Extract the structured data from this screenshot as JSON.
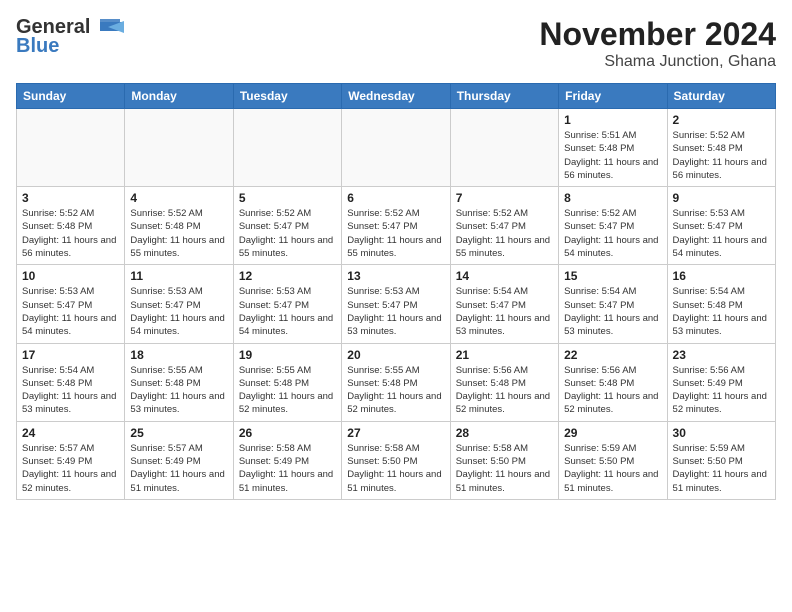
{
  "header": {
    "logo_general": "General",
    "logo_blue": "Blue",
    "title": "November 2024",
    "subtitle": "Shama Junction, Ghana"
  },
  "days_of_week": [
    "Sunday",
    "Monday",
    "Tuesday",
    "Wednesday",
    "Thursday",
    "Friday",
    "Saturday"
  ],
  "weeks": [
    [
      {
        "day": "",
        "info": ""
      },
      {
        "day": "",
        "info": ""
      },
      {
        "day": "",
        "info": ""
      },
      {
        "day": "",
        "info": ""
      },
      {
        "day": "",
        "info": ""
      },
      {
        "day": "1",
        "info": "Sunrise: 5:51 AM\nSunset: 5:48 PM\nDaylight: 11 hours and 56 minutes."
      },
      {
        "day": "2",
        "info": "Sunrise: 5:52 AM\nSunset: 5:48 PM\nDaylight: 11 hours and 56 minutes."
      }
    ],
    [
      {
        "day": "3",
        "info": "Sunrise: 5:52 AM\nSunset: 5:48 PM\nDaylight: 11 hours and 56 minutes."
      },
      {
        "day": "4",
        "info": "Sunrise: 5:52 AM\nSunset: 5:48 PM\nDaylight: 11 hours and 55 minutes."
      },
      {
        "day": "5",
        "info": "Sunrise: 5:52 AM\nSunset: 5:47 PM\nDaylight: 11 hours and 55 minutes."
      },
      {
        "day": "6",
        "info": "Sunrise: 5:52 AM\nSunset: 5:47 PM\nDaylight: 11 hours and 55 minutes."
      },
      {
        "day": "7",
        "info": "Sunrise: 5:52 AM\nSunset: 5:47 PM\nDaylight: 11 hours and 55 minutes."
      },
      {
        "day": "8",
        "info": "Sunrise: 5:52 AM\nSunset: 5:47 PM\nDaylight: 11 hours and 54 minutes."
      },
      {
        "day": "9",
        "info": "Sunrise: 5:53 AM\nSunset: 5:47 PM\nDaylight: 11 hours and 54 minutes."
      }
    ],
    [
      {
        "day": "10",
        "info": "Sunrise: 5:53 AM\nSunset: 5:47 PM\nDaylight: 11 hours and 54 minutes."
      },
      {
        "day": "11",
        "info": "Sunrise: 5:53 AM\nSunset: 5:47 PM\nDaylight: 11 hours and 54 minutes."
      },
      {
        "day": "12",
        "info": "Sunrise: 5:53 AM\nSunset: 5:47 PM\nDaylight: 11 hours and 54 minutes."
      },
      {
        "day": "13",
        "info": "Sunrise: 5:53 AM\nSunset: 5:47 PM\nDaylight: 11 hours and 53 minutes."
      },
      {
        "day": "14",
        "info": "Sunrise: 5:54 AM\nSunset: 5:47 PM\nDaylight: 11 hours and 53 minutes."
      },
      {
        "day": "15",
        "info": "Sunrise: 5:54 AM\nSunset: 5:47 PM\nDaylight: 11 hours and 53 minutes."
      },
      {
        "day": "16",
        "info": "Sunrise: 5:54 AM\nSunset: 5:48 PM\nDaylight: 11 hours and 53 minutes."
      }
    ],
    [
      {
        "day": "17",
        "info": "Sunrise: 5:54 AM\nSunset: 5:48 PM\nDaylight: 11 hours and 53 minutes."
      },
      {
        "day": "18",
        "info": "Sunrise: 5:55 AM\nSunset: 5:48 PM\nDaylight: 11 hours and 53 minutes."
      },
      {
        "day": "19",
        "info": "Sunrise: 5:55 AM\nSunset: 5:48 PM\nDaylight: 11 hours and 52 minutes."
      },
      {
        "day": "20",
        "info": "Sunrise: 5:55 AM\nSunset: 5:48 PM\nDaylight: 11 hours and 52 minutes."
      },
      {
        "day": "21",
        "info": "Sunrise: 5:56 AM\nSunset: 5:48 PM\nDaylight: 11 hours and 52 minutes."
      },
      {
        "day": "22",
        "info": "Sunrise: 5:56 AM\nSunset: 5:48 PM\nDaylight: 11 hours and 52 minutes."
      },
      {
        "day": "23",
        "info": "Sunrise: 5:56 AM\nSunset: 5:49 PM\nDaylight: 11 hours and 52 minutes."
      }
    ],
    [
      {
        "day": "24",
        "info": "Sunrise: 5:57 AM\nSunset: 5:49 PM\nDaylight: 11 hours and 52 minutes."
      },
      {
        "day": "25",
        "info": "Sunrise: 5:57 AM\nSunset: 5:49 PM\nDaylight: 11 hours and 51 minutes."
      },
      {
        "day": "26",
        "info": "Sunrise: 5:58 AM\nSunset: 5:49 PM\nDaylight: 11 hours and 51 minutes."
      },
      {
        "day": "27",
        "info": "Sunrise: 5:58 AM\nSunset: 5:50 PM\nDaylight: 11 hours and 51 minutes."
      },
      {
        "day": "28",
        "info": "Sunrise: 5:58 AM\nSunset: 5:50 PM\nDaylight: 11 hours and 51 minutes."
      },
      {
        "day": "29",
        "info": "Sunrise: 5:59 AM\nSunset: 5:50 PM\nDaylight: 11 hours and 51 minutes."
      },
      {
        "day": "30",
        "info": "Sunrise: 5:59 AM\nSunset: 5:50 PM\nDaylight: 11 hours and 51 minutes."
      }
    ]
  ]
}
